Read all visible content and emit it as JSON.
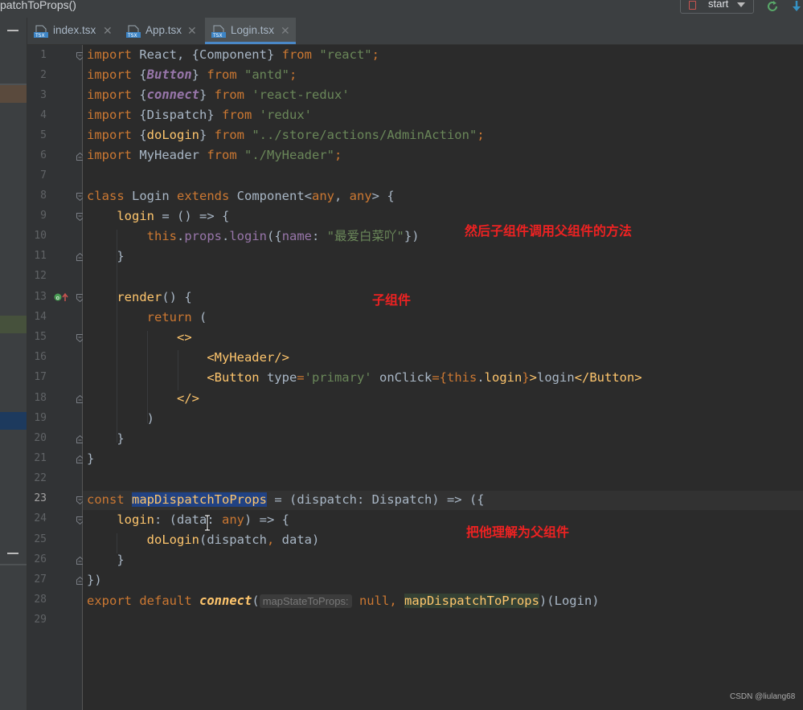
{
  "window": {
    "breadcrumb": "patchToProps()",
    "run_config_label": "start",
    "colors": {
      "accent_tab": "#4a88c7",
      "keyword": "#cc7832",
      "string": "#6a8759",
      "function": "#ffc66d",
      "field": "#9876aa",
      "annotation": "#ee2222"
    }
  },
  "tabs": [
    {
      "label": "index.tsx",
      "icon": "tsx-file-icon",
      "active": false
    },
    {
      "label": "App.tsx",
      "icon": "tsx-file-icon",
      "active": false
    },
    {
      "label": "Login.tsx",
      "icon": "tsx-file-icon",
      "active": true
    }
  ],
  "gutter": {
    "line_numbers": [
      "1",
      "2",
      "3",
      "4",
      "5",
      "6",
      "7",
      "8",
      "9",
      "10",
      "11",
      "12",
      "13",
      "14",
      "15",
      "16",
      "17",
      "18",
      "19",
      "20",
      "21",
      "22",
      "23",
      "24",
      "25",
      "26",
      "27",
      "28",
      "29"
    ],
    "current_line": "23"
  },
  "code": {
    "l1": {
      "t1": "import",
      "t2": " React, {Component} ",
      "t3": "from",
      "t4": " ",
      "t5": "\"react\"",
      "t6": ";"
    },
    "l2": {
      "t1": "import",
      "t2": " {",
      "t3": "Button",
      "t4": "} ",
      "t5": "from",
      "t6": " ",
      "t7": "\"antd\"",
      "t8": ";"
    },
    "l3": {
      "t1": "import",
      "t2": " {",
      "t3": "connect",
      "t4": "} ",
      "t5": "from",
      "t6": " ",
      "t7": "'react-redux'"
    },
    "l4": {
      "t1": "import",
      "t2": " {Dispatch} ",
      "t3": "from",
      "t4": " ",
      "t5": "'redux'"
    },
    "l5": {
      "t1": "import",
      "t2": " {",
      "t3": "doLogin",
      "t4": "} ",
      "t5": "from",
      "t6": " ",
      "t7": "\"../store/actions/AdminAction\"",
      "t8": ";"
    },
    "l6": {
      "t1": "import",
      "t2": " MyHeader ",
      "t3": "from",
      "t4": " ",
      "t5": "\"./MyHeader\"",
      "t6": ";"
    },
    "l8": {
      "t1": "class",
      "t2": " Login ",
      "t3": "extends",
      "t4": " Component<",
      "t5": "any",
      "t6": ", ",
      "t7": "any",
      "t8": "> {"
    },
    "l9": {
      "indent": "    ",
      "t1": "login",
      "t2": " = () => {"
    },
    "l10": {
      "indent": "        ",
      "t1": "this",
      "t2": ".",
      "t3": "props",
      "t4": ".",
      "t5": "login",
      "t6": "({",
      "t7": "name",
      "t8": ": ",
      "t9": "\"最爱白菜吖\"",
      "t10": "})"
    },
    "l11": {
      "indent": "    ",
      "t1": "}"
    },
    "l13": {
      "indent": "    ",
      "t1": "render",
      "t2": "() {"
    },
    "l14": {
      "indent": "        ",
      "t1": "return",
      "t2": " ("
    },
    "l15": {
      "indent": "            ",
      "t1": "<>"
    },
    "l16": {
      "indent": "                ",
      "t1": "<MyHeader/>"
    },
    "l17": {
      "indent": "                ",
      "t1": "<Button ",
      "t2": "type",
      "t3": "=",
      "t4": "'primary'",
      "t5": " ",
      "t6": "onClick",
      "t7": "={",
      "t8": "this",
      "t9": ".",
      "t10": "login",
      "t11": "}",
      "t12": ">",
      "t13": "login",
      "t14": "</Button>"
    },
    "l18": {
      "indent": "            ",
      "t1": "</>"
    },
    "l19": {
      "indent": "        ",
      "t1": ")"
    },
    "l20": {
      "indent": "    ",
      "t1": "}"
    },
    "l21": {
      "t1": "}"
    },
    "l23": {
      "t1": "const",
      "t2": " ",
      "t3": "mapDispatchToProps",
      "t4": " = (dispatch: Dispatch) => ({"
    },
    "l24": {
      "indent": "    ",
      "t1": "login",
      "t2": ": (data: ",
      "t3": "any",
      "t4": ") => {"
    },
    "l25": {
      "indent": "        ",
      "t1": "doLogin",
      "t2": "(dispatch",
      "t3": ",",
      "t4": " data)"
    },
    "l26": {
      "indent": "    ",
      "t1": "}"
    },
    "l27": {
      "t1": "})"
    },
    "l28": {
      "t1": "export",
      "t2": " ",
      "t3": "default",
      "t4": " ",
      "t5": "connect",
      "t6": "(",
      "t7": "mapStateToProps:",
      "t8": " null",
      "t9": ", ",
      "t10": "mapDispatchToProps",
      "t11": ")(Login)"
    }
  },
  "annotations": {
    "child_calls_parent": "然后子组件调用父组件的方法",
    "child_component": "子组件",
    "parent_component": "把他理解为父组件"
  },
  "watermark": "CSDN @liulang68"
}
